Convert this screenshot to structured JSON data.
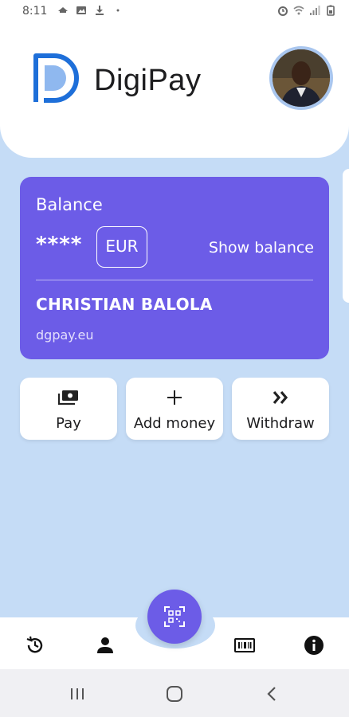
{
  "status_bar": {
    "time": "8:11",
    "left_icons": [
      "teamviewer-icon",
      "image-icon",
      "download-icon",
      "dot-icon"
    ],
    "right_icons": [
      "alarm-icon",
      "wifi-icon",
      "signal-icon",
      "battery-icon"
    ]
  },
  "header": {
    "brand": "DigiPay",
    "logo_icon": "digipay-logo-icon",
    "avatar_icon": "user-avatar"
  },
  "balance_card": {
    "title": "Balance",
    "masked_amount": "****",
    "currency": "EUR",
    "show_balance_label": "Show balance",
    "holder_name": "CHRISTIAN BALOLA",
    "domain": "dgpay.eu"
  },
  "actions": [
    {
      "label": "Pay",
      "icon": "wallet-cash-icon"
    },
    {
      "label": "Add money",
      "icon": "plus-icon"
    },
    {
      "label": "Withdraw",
      "icon": "double-chevron-right-icon"
    }
  ],
  "bottom_nav": {
    "items": [
      "history-icon",
      "profile-icon",
      "qr-scan-icon",
      "barcode-card-icon",
      "info-icon"
    ]
  },
  "system_nav": [
    "recent-apps-icon",
    "home-icon",
    "back-icon"
  ],
  "colors": {
    "accent": "#6c5ce7",
    "background": "#c5dcf6",
    "logo_blue": "#1e6fd9",
    "logo_light": "#8fb8ef"
  }
}
